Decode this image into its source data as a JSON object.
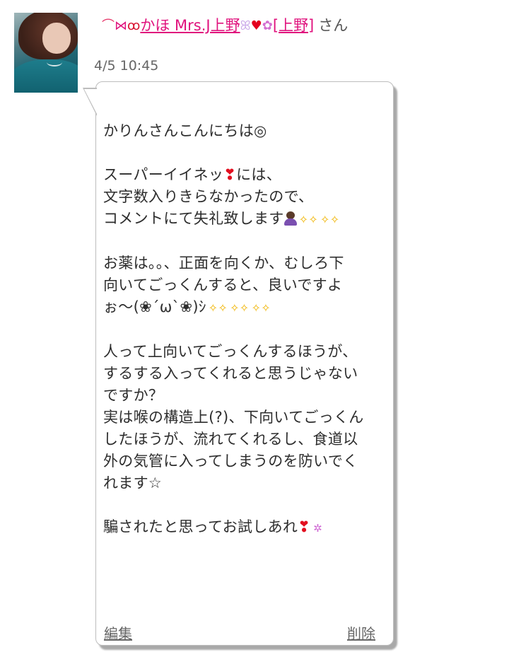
{
  "author": {
    "name": "かほ Mrs.J上野",
    "name_suffix": "[上野]",
    "honorific": "さん",
    "decorations": [
      "rainbow-icon",
      "ribbon-icon",
      "cherry-icon",
      "bunny-icon",
      "heart-icon",
      "flower-icon"
    ]
  },
  "post": {
    "timestamp": "4/5 10:45",
    "lines": [
      "かりんさんこんにちは◎",
      "",
      "スーパーイイネッ",
      "には、",
      "文字数入りきらなかったので、",
      "コメントにて失礼致します",
      "",
      "お薬は。。、正面を向くか、むしろ下",
      "向いてごっくんすると、良いですよ",
      "ぉ～(❀´ω`❀)ｼ",
      "",
      "人って上向いてごっくんするほうが、",
      "するする入ってくれると思うじゃない",
      "ですか？",
      "実は喉の構造上(?)、下向いてごっくん",
      "したほうが、流れてくれるし、食道以",
      "外の気管に入ってしまうのを防いでく",
      "れます☆",
      "",
      "騙されたと思ってお試しあれ"
    ]
  },
  "actions": {
    "edit_label": "編集",
    "delete_label": "削除"
  },
  "colors": {
    "author_link": "#e0127d",
    "heart": "#e20f1f",
    "sparkle": "#f0b400",
    "text": "#2d2d2d"
  }
}
